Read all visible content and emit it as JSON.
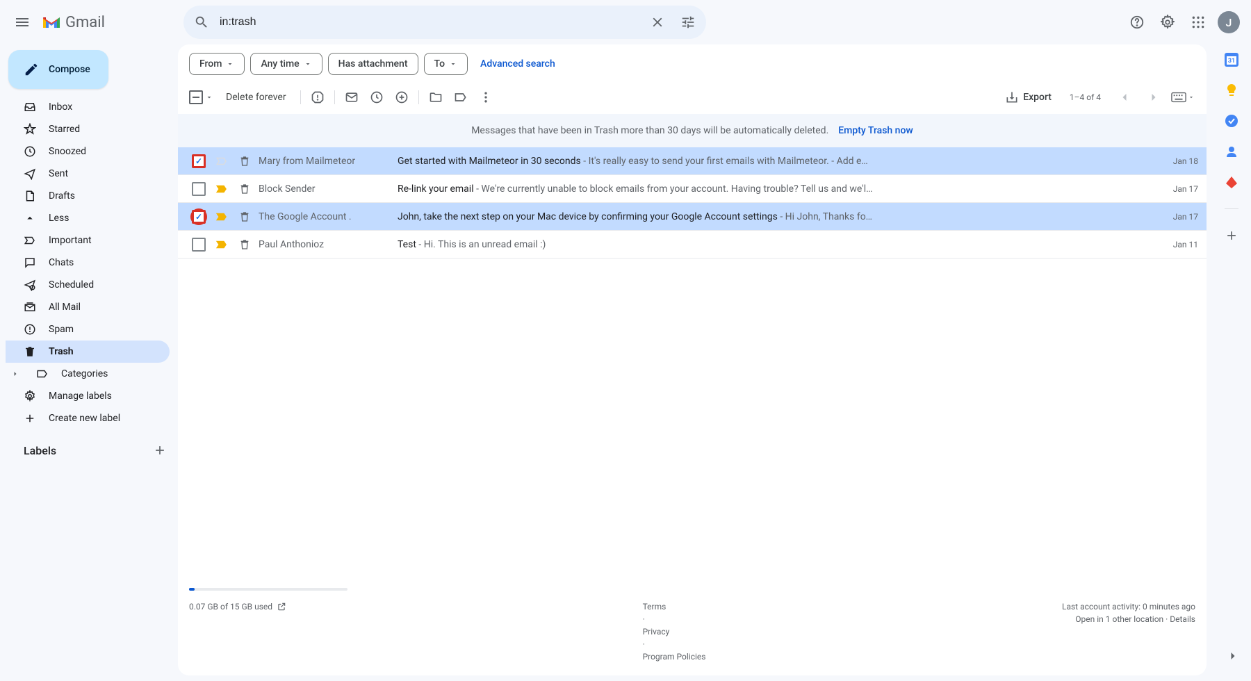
{
  "header": {
    "app_name": "Gmail",
    "search_value": "in:trash",
    "avatar_initial": "J"
  },
  "sidebar": {
    "compose_label": "Compose",
    "items": [
      {
        "label": "Inbox",
        "icon": "inbox"
      },
      {
        "label": "Starred",
        "icon": "star"
      },
      {
        "label": "Snoozed",
        "icon": "clock"
      },
      {
        "label": "Sent",
        "icon": "sent"
      },
      {
        "label": "Drafts",
        "icon": "draft"
      },
      {
        "label": "Less",
        "icon": "chevup"
      },
      {
        "label": "Important",
        "icon": "imp"
      },
      {
        "label": "Chats",
        "icon": "chat"
      },
      {
        "label": "Scheduled",
        "icon": "sched"
      },
      {
        "label": "All Mail",
        "icon": "allmail"
      },
      {
        "label": "Spam",
        "icon": "spam"
      },
      {
        "label": "Trash",
        "icon": "trash",
        "active": true
      },
      {
        "label": "Categories",
        "icon": "cat",
        "hasExpand": true
      },
      {
        "label": "Manage labels",
        "icon": "gear"
      },
      {
        "label": "Create new label",
        "icon": "plus"
      }
    ],
    "labels_header": "Labels"
  },
  "filters": {
    "from": "From",
    "anytime": "Any time",
    "hasatt": "Has attachment",
    "to": "To",
    "adv": "Advanced search"
  },
  "toolbar": {
    "delete_forever": "Delete forever",
    "export": "Export",
    "page_count": "1–4 of 4"
  },
  "banner": {
    "msg": "Messages that have been in Trash more than 30 days will be automatically deleted.",
    "empty": "Empty Trash now"
  },
  "emails": [
    {
      "selected": true,
      "focus": false,
      "important": false,
      "sender": "Mary from Mailmeteor",
      "subject": "Get started with Mailmeteor in 30 seconds",
      "snippet": " - It's really easy to send your first emails with Mailmeteor. - Add e…",
      "date": "Jan 18"
    },
    {
      "selected": false,
      "focus": false,
      "important": true,
      "sender": "Block Sender",
      "subject": "Re-link your email",
      "snippet": " - We're currently unable to block emails from your account. Having trouble? Tell us and we'l…",
      "date": "Jan 17"
    },
    {
      "selected": true,
      "focus": true,
      "important": true,
      "sender": "The Google Account .",
      "subject": "John, take the next step on your Mac device by confirming your Google Account settings",
      "snippet": " - Hi John, Thanks fo…",
      "date": "Jan 17"
    },
    {
      "selected": false,
      "focus": false,
      "important": true,
      "sender": "Paul Anthonioz",
      "subject": "Test",
      "snippet": " - Hi. This is an unread email :)",
      "date": "Jan 11"
    }
  ],
  "footer": {
    "storage": "0.07 GB of 15 GB used",
    "terms": "Terms",
    "privacy": "Privacy",
    "policies": "Program Policies",
    "activity": "Last account activity: 0 minutes ago",
    "openin": "Open in 1 other location · ",
    "details": "Details"
  }
}
